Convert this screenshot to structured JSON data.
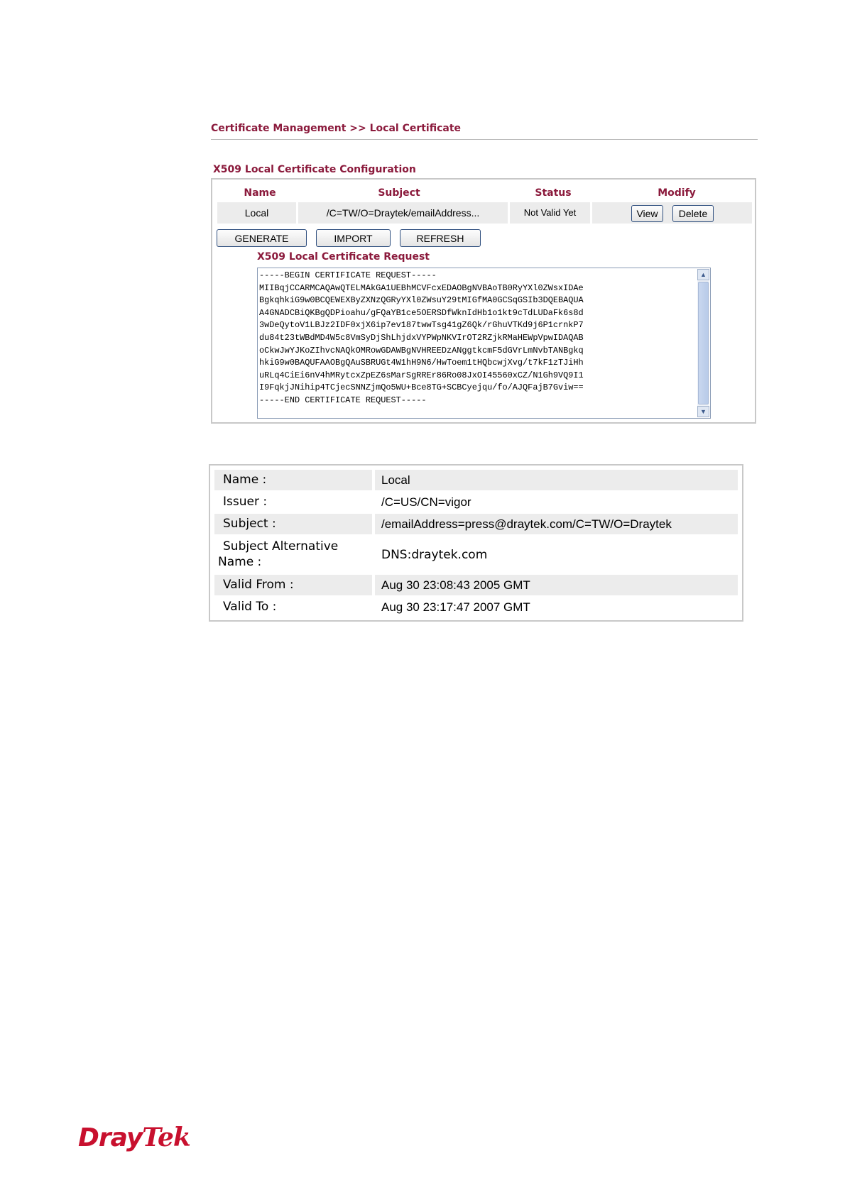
{
  "breadcrumb": "Certificate Management >> Local Certificate",
  "config": {
    "title": "X509 Local Certificate Configuration",
    "headers": {
      "name": "Name",
      "subject": "Subject",
      "status": "Status",
      "modify": "Modify"
    },
    "row": {
      "name": "Local",
      "subject": "/C=TW/O=Draytek/emailAddress...",
      "status": "Not Valid Yet",
      "view_label": "View",
      "delete_label": "Delete"
    },
    "buttons": {
      "generate": "GENERATE",
      "import": "IMPORT",
      "refresh": "REFRESH"
    },
    "request_title": "X509 Local Certificate Request",
    "request_text": "-----BEGIN CERTIFICATE REQUEST-----\nMIIBqjCCARMCAQAwQTELMAkGA1UEBhMCVFcxEDAOBgNVBAoTB0RyYXl0ZWsxIDAe\nBgkqhkiG9w0BCQEWEXByZXNzQGRyYXl0ZWsuY29tMIGfMA0GCSqGSIb3DQEBAQUA\nA4GNADCBiQKBgQDPioahu/gFQaYB1ce5OERSDfWknIdHb1o1kt9cTdLUDaFk6s8d\n3wDeQytoV1LBJz2IDF0xjX6ip7ev187twwTsg41gZ6Qk/rGhuVTKd9j6P1crnkP7\ndu84t23tWBdMD4W5c8VmSyDjShLhjdxVYPWpNKVIrOT2RZjkRMaHEWpVpwIDAQAB\noCkwJwYJKoZIhvcNAQkOMRowGDAWBgNVHREEDzANggtkcmF5dGVrLmNvbTANBgkq\nhkiG9w0BAQUFAAOBgQAuSBRUGt4W1hH9N6/HwToem1tHQbcwjXvg/t7kF1zTJiHh\nuRLq4CiEi6nV4hMRytcxZpEZ6sMarSgRREr86Ro08JxOI45560xCZ/N1Gh9VQ9I1\nI9FqkjJNihip4TCjecSNNZjmQo5WU+Bce8TG+SCBCyejqu/fo/AJQFajB7Gviw==\n-----END CERTIFICATE REQUEST-----"
  },
  "details": {
    "name_label": "Name :",
    "name_value": "Local",
    "issuer_label": "Issuer :",
    "issuer_value": "/C=US/CN=vigor",
    "subject_label": "Subject :",
    "subject_value": "/emailAddress=press@draytek.com/C=TW/O=Draytek",
    "alt_label_line1": "Subject Alternative",
    "alt_label_line2": "Name :",
    "alt_value": "DNS:draytek.com",
    "valid_from_label": "Valid From :",
    "valid_from_value": "Aug 30 23:08:43 2005 GMT",
    "valid_to_label": "Valid To :",
    "valid_to_value": "Aug 30 23:17:47 2007 GMT"
  },
  "logo": {
    "part1": "Dray",
    "part2": "Tek"
  },
  "colors": {
    "accent": "#8b1a3c",
    "logo": "#c8102e",
    "row_shade": "#ececec"
  }
}
